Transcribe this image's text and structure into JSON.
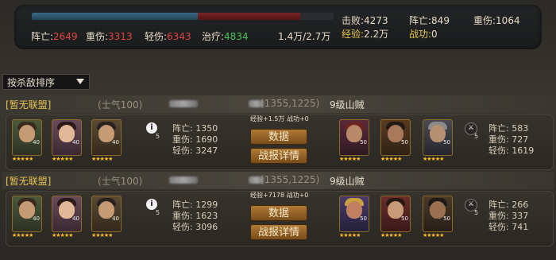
{
  "summary": {
    "progress": {
      "blue_fraction": 0.55,
      "red_fraction": 0.34
    },
    "dead_label": "阵亡:",
    "dead_value": "2649",
    "heavy_label": "重伤:",
    "heavy_value": "3313",
    "light_label": "轻伤:",
    "light_value": "6343",
    "heal_label": "治疗:",
    "heal_value": "4834",
    "power": "1.4万/2.7万",
    "kills_label": "击败:",
    "kills_value": "4273",
    "exp_label": "经验:",
    "exp_value": "2.2万",
    "enemy_dead_label": "阵亡:",
    "enemy_dead_value": "849",
    "merit_label": "战功:",
    "merit_value": "0",
    "enemy_heavy_label": "重伤:",
    "enemy_heavy_value": "1064"
  },
  "sort": {
    "label": "按杀敌排序"
  },
  "battles": [
    {
      "alliance": "[暂无联盟]",
      "morale": "(士气100)",
      "coords": "(1355,1225)",
      "enemy": "9级山贼",
      "my_levels": [
        "40",
        "40",
        "40"
      ],
      "my_tag": "5",
      "my_dead_label": "阵亡:",
      "my_dead": "1350",
      "my_heavy_label": "重伤:",
      "my_heavy": "1690",
      "my_light_label": "轻伤:",
      "my_light": "3247",
      "gain": "经验+1.5万 战功+0",
      "data_button": "数据",
      "detail_button": "战报详情",
      "enemy_levels": [
        "50",
        "50",
        "50"
      ],
      "enemy_tag": "5",
      "enemy_dead_label": "阵亡:",
      "enemy_dead": "583",
      "enemy_heavy_label": "重伤:",
      "enemy_heavy": "727",
      "enemy_light_label": "轻伤:",
      "enemy_light": "1619"
    },
    {
      "alliance": "[暂无联盟]",
      "morale": "(士气100)",
      "coords": "(1355,1225)",
      "enemy": "9级山贼",
      "my_levels": [
        "40",
        "40",
        "40"
      ],
      "my_tag": "5",
      "my_dead_label": "阵亡:",
      "my_dead": "1299",
      "my_heavy_label": "重伤:",
      "my_heavy": "1623",
      "my_light_label": "轻伤:",
      "my_light": "3096",
      "gain": "经验+7178 战功+0",
      "data_button": "数据",
      "detail_button": "战报详情",
      "enemy_levels": [
        "50",
        "50",
        "50"
      ],
      "enemy_tag": "5",
      "enemy_dead_label": "阵亡:",
      "enemy_dead": "266",
      "enemy_heavy_label": "重伤:",
      "enemy_heavy": "337",
      "enemy_light_label": "轻伤:",
      "enemy_light": "741"
    }
  ]
}
